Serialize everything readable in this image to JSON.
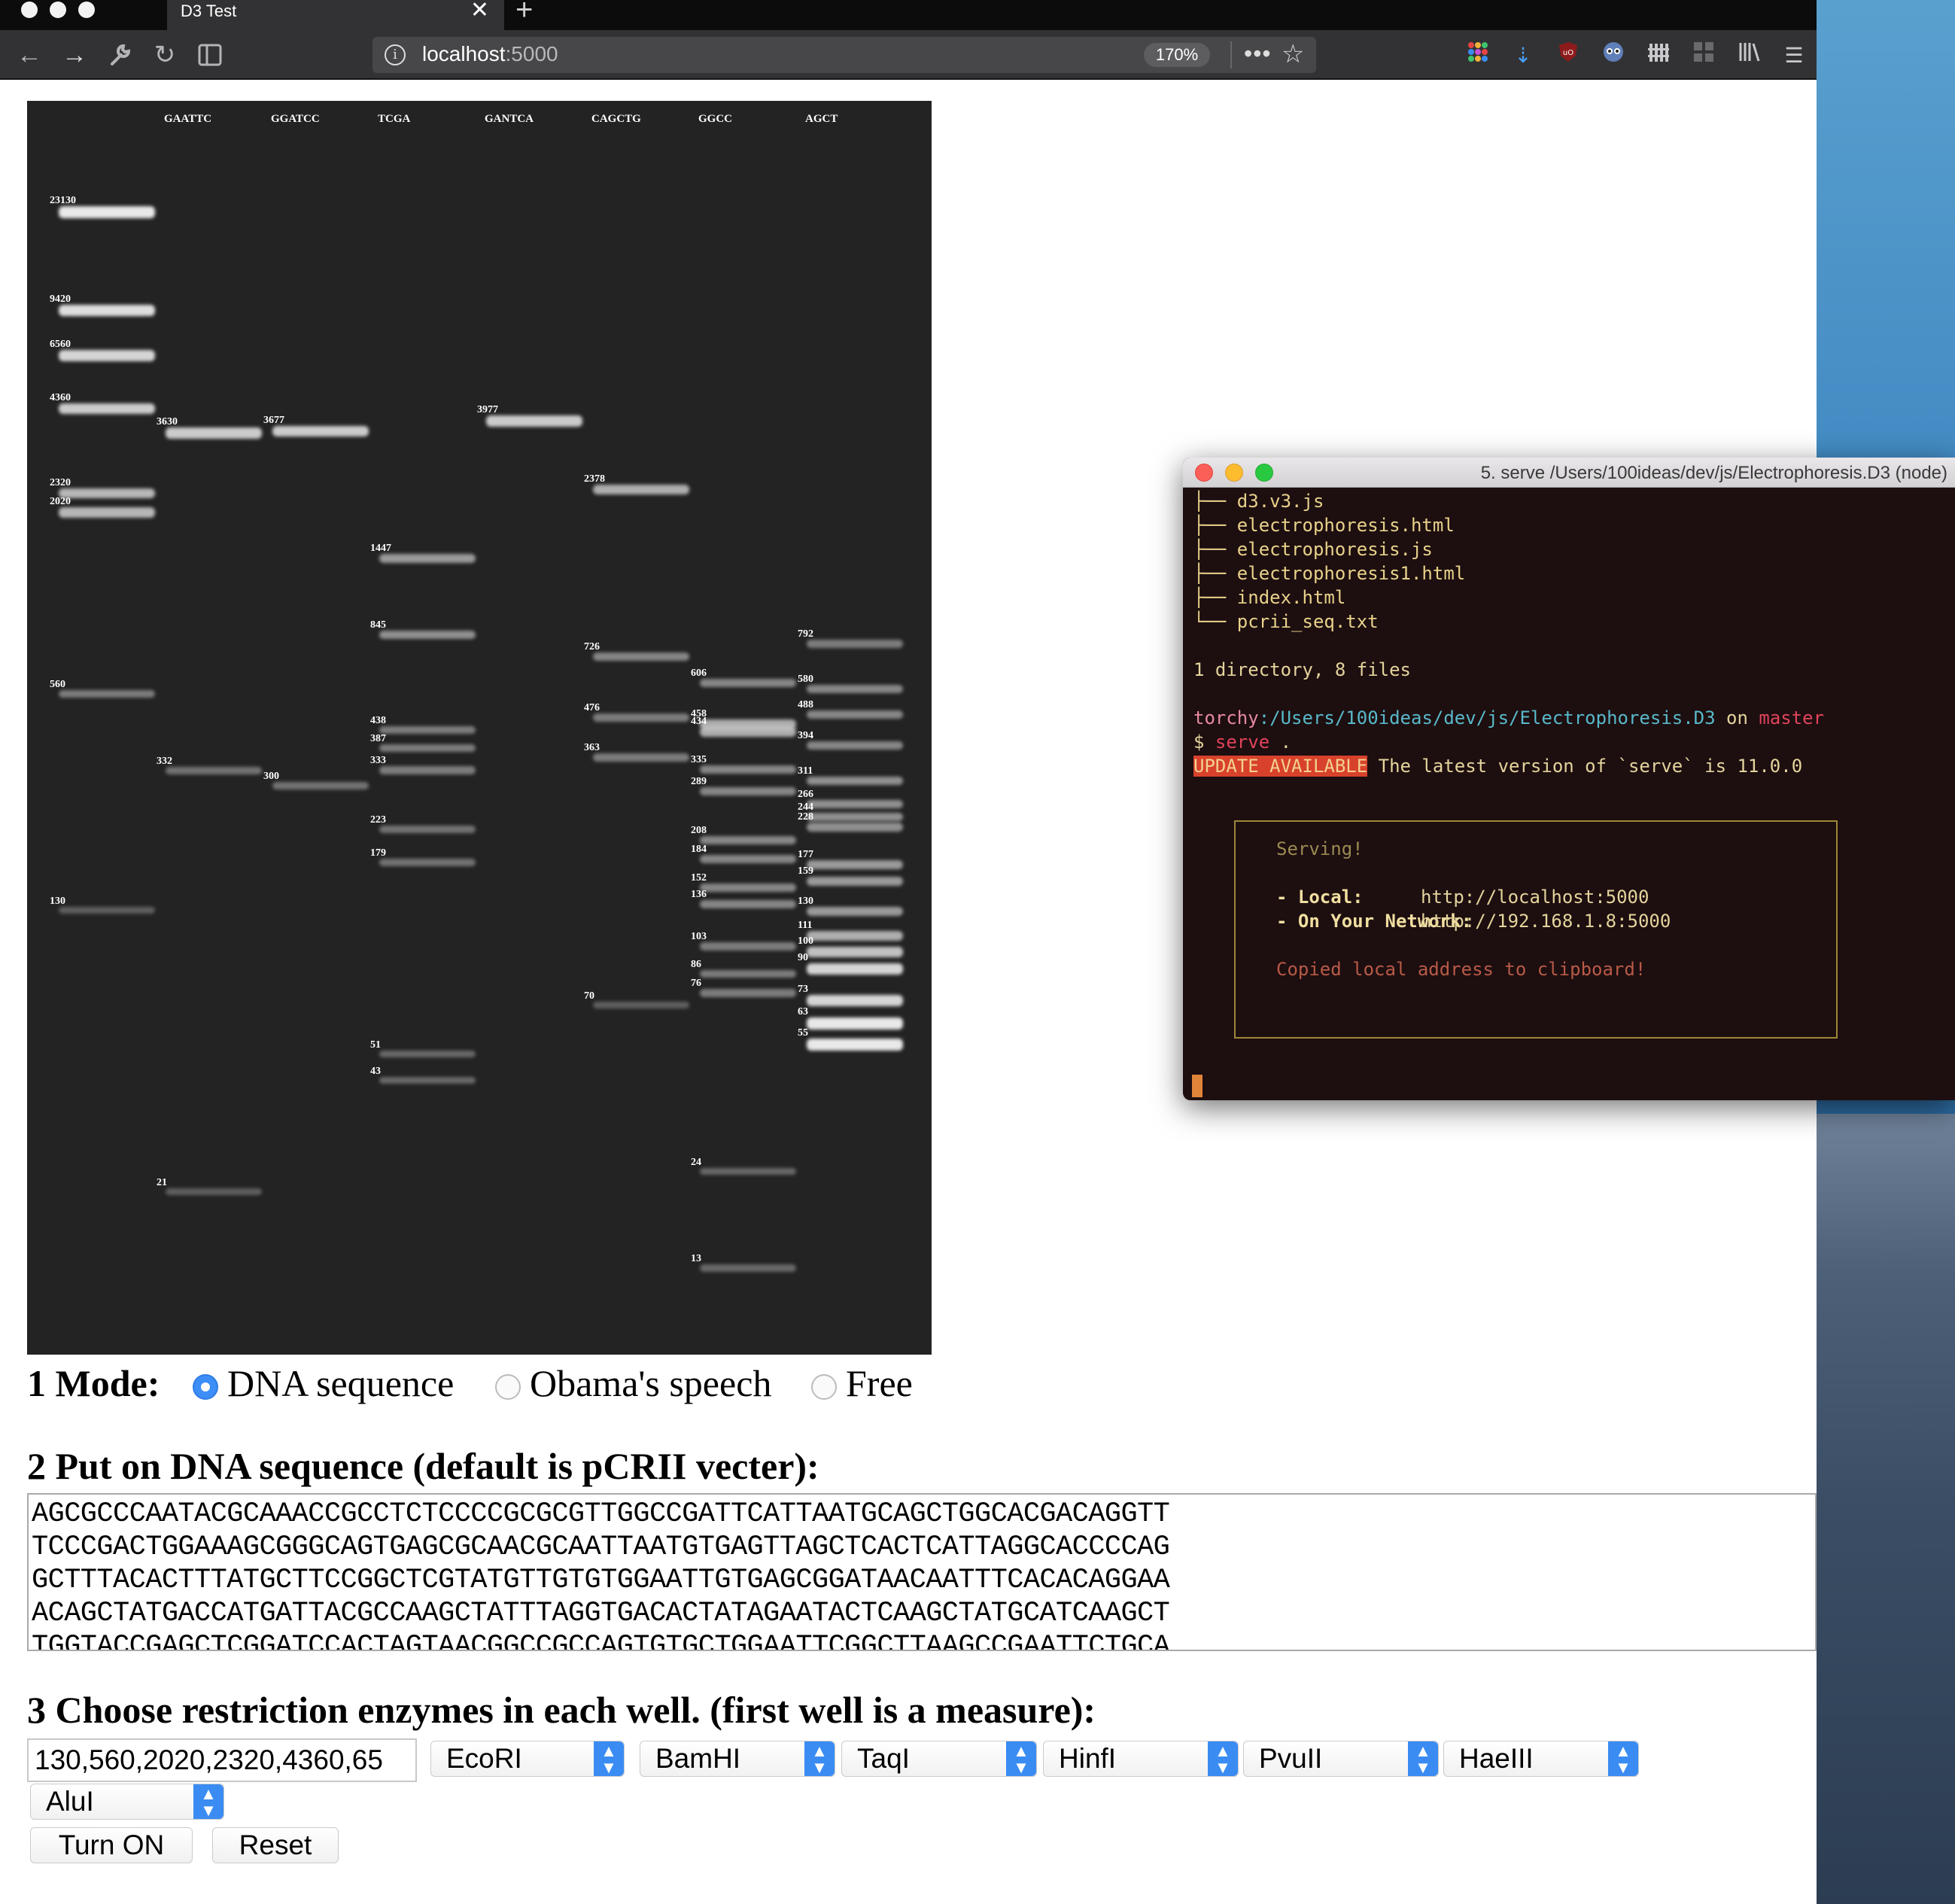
{
  "browser": {
    "tab_title": "D3 Test",
    "url_host": "localhost",
    "url_port": ":5000",
    "zoom": "170%",
    "url_more": "•••"
  },
  "gel": {
    "lanes": [
      {
        "header": "",
        "bands": [
          {
            "size": "23130",
            "strength": 1.0
          },
          {
            "size": "9420",
            "strength": 0.95
          },
          {
            "size": "6560",
            "strength": 0.9
          },
          {
            "size": "4360",
            "strength": 0.85
          },
          {
            "size": "2320",
            "strength": 0.75
          },
          {
            "size": "2020",
            "strength": 0.75
          },
          {
            "size": "560",
            "strength": 0.45
          },
          {
            "size": "130",
            "strength": 0.3
          }
        ]
      },
      {
        "header": "GAATTC",
        "bands": [
          {
            "size": "3630",
            "strength": 0.85
          },
          {
            "size": "332",
            "strength": 0.4
          },
          {
            "size": "21",
            "strength": 0.3
          }
        ]
      },
      {
        "header": "GGATCC",
        "bands": [
          {
            "size": "3677",
            "strength": 0.85
          },
          {
            "size": "300",
            "strength": 0.4
          }
        ]
      },
      {
        "header": "TCGA",
        "bands": [
          {
            "size": "1447",
            "strength": 0.6
          },
          {
            "size": "845",
            "strength": 0.55
          },
          {
            "size": "438",
            "strength": 0.45
          },
          {
            "size": "387",
            "strength": 0.45
          },
          {
            "size": "333",
            "strength": 0.45
          },
          {
            "size": "223",
            "strength": 0.4
          },
          {
            "size": "179",
            "strength": 0.4
          },
          {
            "size": "51",
            "strength": 0.35
          },
          {
            "size": "43",
            "strength": 0.35
          }
        ]
      },
      {
        "header": "GANTCA",
        "bands": [
          {
            "size": "3977",
            "strength": 0.85
          }
        ]
      },
      {
        "header": "CAGCTG",
        "bands": [
          {
            "size": "2378",
            "strength": 0.7
          },
          {
            "size": "726",
            "strength": 0.5
          },
          {
            "size": "476",
            "strength": 0.45
          },
          {
            "size": "363",
            "strength": 0.45
          },
          {
            "size": "70",
            "strength": 0.3
          }
        ]
      },
      {
        "header": "GGCC",
        "bands": [
          {
            "size": "606",
            "strength": 0.5
          },
          {
            "size": "458",
            "strength": 0.7
          },
          {
            "size": "434",
            "strength": 0.7
          },
          {
            "size": "335",
            "strength": 0.5
          },
          {
            "size": "289",
            "strength": 0.5
          },
          {
            "size": "208",
            "strength": 0.5
          },
          {
            "size": "184",
            "strength": 0.5
          },
          {
            "size": "152",
            "strength": 0.5
          },
          {
            "size": "136",
            "strength": 0.5
          },
          {
            "size": "103",
            "strength": 0.45
          },
          {
            "size": "86",
            "strength": 0.45
          },
          {
            "size": "76",
            "strength": 0.45
          },
          {
            "size": "24",
            "strength": 0.35
          },
          {
            "size": "13",
            "strength": 0.35
          }
        ]
      },
      {
        "header": "AGCT",
        "bands": [
          {
            "size": "792",
            "strength": 0.45
          },
          {
            "size": "580",
            "strength": 0.5
          },
          {
            "size": "488",
            "strength": 0.5
          },
          {
            "size": "394",
            "strength": 0.5
          },
          {
            "size": "311",
            "strength": 0.55
          },
          {
            "size": "266",
            "strength": 0.55
          },
          {
            "size": "244",
            "strength": 0.55
          },
          {
            "size": "228",
            "strength": 0.55
          },
          {
            "size": "177",
            "strength": 0.6
          },
          {
            "size": "159",
            "strength": 0.6
          },
          {
            "size": "130",
            "strength": 0.6
          },
          {
            "size": "111",
            "strength": 0.7
          },
          {
            "size": "100",
            "strength": 0.8
          },
          {
            "size": "90",
            "strength": 0.9
          },
          {
            "size": "73",
            "strength": 0.9
          },
          {
            "size": "63",
            "strength": 1.0
          },
          {
            "size": "55",
            "strength": 1.0
          }
        ]
      }
    ]
  },
  "terminal": {
    "title": "5. serve /Users/100ideas/dev/js/Electrophoresis.D3 (node)",
    "tree_lines": [
      "├── d3.v3.js",
      "├── electrophoresis.html",
      "├── electrophoresis.js",
      "├── electrophoresis1.html",
      "├── index.html",
      "└── pcrii_seq.txt"
    ],
    "summary": "1 directory, 8 files",
    "prompt_user": "torchy",
    "prompt_path": ":/Users/100ideas/dev/js/Electrophoresis.D3",
    "prompt_on": " on ",
    "prompt_branch": "master",
    "cmd_prefix": "$ ",
    "cmd": "serve",
    "cmd_arg": " .",
    "update_badge": "UPDATE AVAILABLE",
    "update_text": " The latest version of `serve` is 11.0.0",
    "serving": "Serving!",
    "local_label": "- Local:",
    "local_url": "http://localhost:5000",
    "network_label": "- On Your Network:",
    "network_url": "http://192.168.1.8:5000",
    "copied": "Copied local address to clipboard!"
  },
  "form": {
    "mode_label": "1 Mode:",
    "modes": [
      "DNA sequence",
      "Obama's speech",
      "Free"
    ],
    "selected_mode": 0,
    "sequence_heading": "2 Put on DNA sequence (default is pCRII vecter):",
    "sequence_lines": [
      "AGCGCCCAATACGCAAACCGCCTCTCCCCGCGCGTTGGCCGATTCATTAATGCAGCTGGCACGACAGGTT",
      "TCCCGACTGGAAAGCGGGCAGTGAGCGCAACGCAATTAATGTGAGTTAGCTCACTCATTAGGCACCCCAG",
      "GCTTTACACTTTATGCTTCCGGCTCGTATGTTGTGTGGAATTGTGAGCGGATAACAATTTCACACAGGAA",
      "ACAGCTATGACCATGATTACGCCAAGCTATTTAGGTGACACTATAGAATACTCAAGCTATGCATCAAGCT",
      "TGGTACCGAGCTCGGATCCACTAGTAACGGCCGCCAGTGTGCTGGAATTCGGCTTAAGCCGAATTCTGCA"
    ],
    "enzyme_heading": "3 Choose restriction enzymes in each well. (first well is a measure):",
    "measure_value": "130,560,2020,2320,4360,65",
    "enzymes": [
      "EcoRI",
      "BamHI",
      "TaqI",
      "HinfI",
      "PvuII",
      "HaeIII",
      "AluI"
    ],
    "turn_on": "Turn ON",
    "reset": "Reset"
  }
}
